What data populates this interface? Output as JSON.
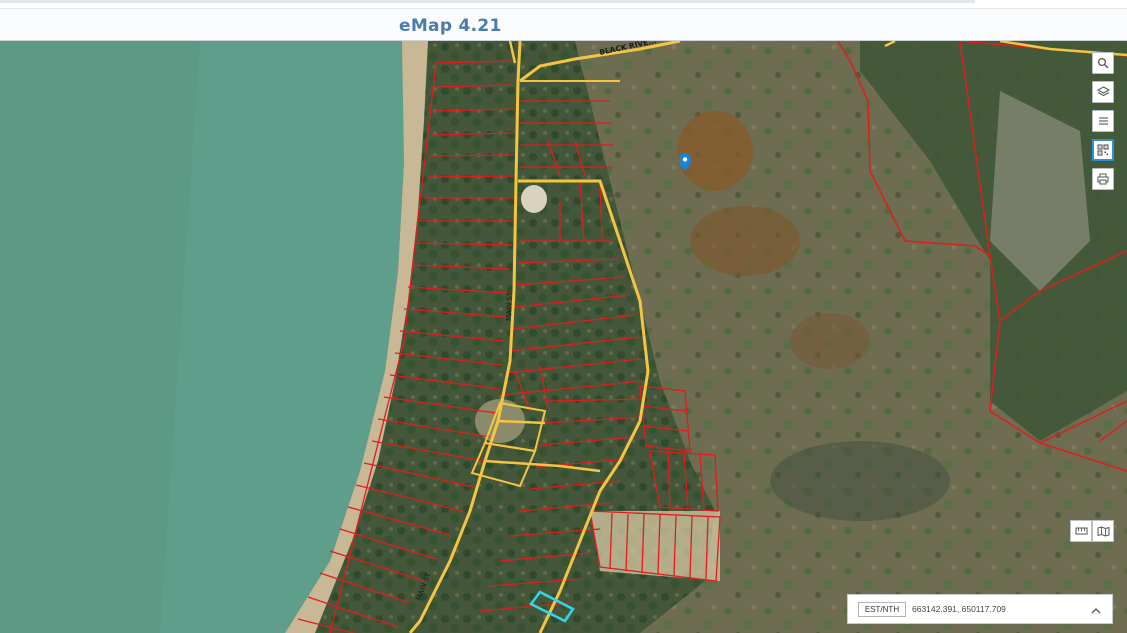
{
  "header": {
    "title": "eMap 4.21"
  },
  "map": {
    "road_labels": [
      "BLACK RIVE...",
      "MAIN ST",
      "MAIN ST"
    ],
    "colors": {
      "sea": "#5f9e8a",
      "beach": "#cdbb97",
      "vegetation": "#4a5b38",
      "wetland": "#6b6a4c",
      "parcel_line": "#e21c1c",
      "road_line": "#f5c542",
      "selection": "#2fd8e8",
      "marker": "#1a84d6"
    }
  },
  "toolbar": {
    "right": [
      {
        "name": "search",
        "icon": "search-icon"
      },
      {
        "name": "layers",
        "icon": "layers-icon"
      },
      {
        "name": "menu",
        "icon": "menu-icon"
      },
      {
        "name": "qr",
        "icon": "qr-code-icon"
      },
      {
        "name": "print",
        "icon": "print-icon"
      }
    ],
    "bottom": [
      {
        "name": "measure",
        "icon": "ruler-icon"
      },
      {
        "name": "basemap",
        "icon": "map-icon"
      }
    ]
  },
  "coordinates": {
    "system": "EST/NTH",
    "value": "663142.391, 650117.709"
  }
}
